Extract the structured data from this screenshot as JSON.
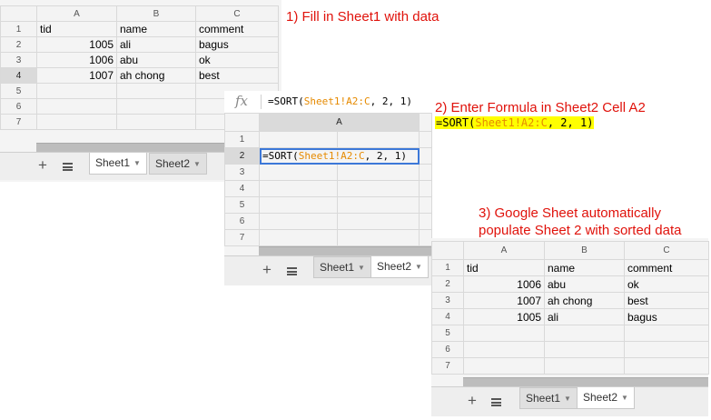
{
  "step1": {
    "caption": "1) Fill in Sheet1 with data",
    "columns": [
      "A",
      "B",
      "C"
    ],
    "row_numbers": [
      "1",
      "2",
      "3",
      "4",
      "5",
      "6",
      "7"
    ],
    "rows": [
      [
        "tid",
        "name",
        "comment"
      ],
      [
        "1005",
        "ali",
        "bagus"
      ],
      [
        "1006",
        "abu",
        "ok"
      ],
      [
        "1007",
        "ah chong",
        "best"
      ],
      [
        "",
        "",
        ""
      ],
      [
        "",
        "",
        ""
      ],
      [
        "",
        "",
        ""
      ]
    ],
    "tabs": [
      "Sheet1",
      "Sheet2"
    ]
  },
  "step2": {
    "caption": "2) Enter Formula in Sheet2 Cell A2",
    "formula_prefix": "=SORT(",
    "formula_range": "Sheet1!A2:C",
    "formula_args": ", 2, 1)",
    "formula_bar_label": "fx",
    "columns": [
      "A",
      "B"
    ],
    "row_numbers": [
      "1",
      "2",
      "3",
      "4",
      "5",
      "6",
      "7"
    ],
    "tabs": [
      "Sheet1",
      "Sheet2"
    ]
  },
  "step3": {
    "caption_line1": "3) Google Sheet automatically",
    "caption_line2": "populate Sheet 2 with sorted data",
    "columns": [
      "A",
      "B",
      "C"
    ],
    "row_numbers": [
      "1",
      "2",
      "3",
      "4",
      "5",
      "6",
      "7"
    ],
    "rows": [
      [
        "tid",
        "name",
        "comment"
      ],
      [
        "1006",
        "abu",
        "ok"
      ],
      [
        "1007",
        "ah chong",
        "best"
      ],
      [
        "1005",
        "ali",
        "bagus"
      ],
      [
        "",
        "",
        ""
      ],
      [
        "",
        "",
        ""
      ],
      [
        "",
        "",
        ""
      ]
    ],
    "tabs": [
      "Sheet1",
      "Sheet2"
    ]
  },
  "colors": {
    "caption_red": "#e0120b",
    "range_orange": "#e68a00",
    "number_blue": "#3a62d6",
    "highlight_yellow": "#ffff00",
    "selection_blue": "#3c78d8"
  }
}
